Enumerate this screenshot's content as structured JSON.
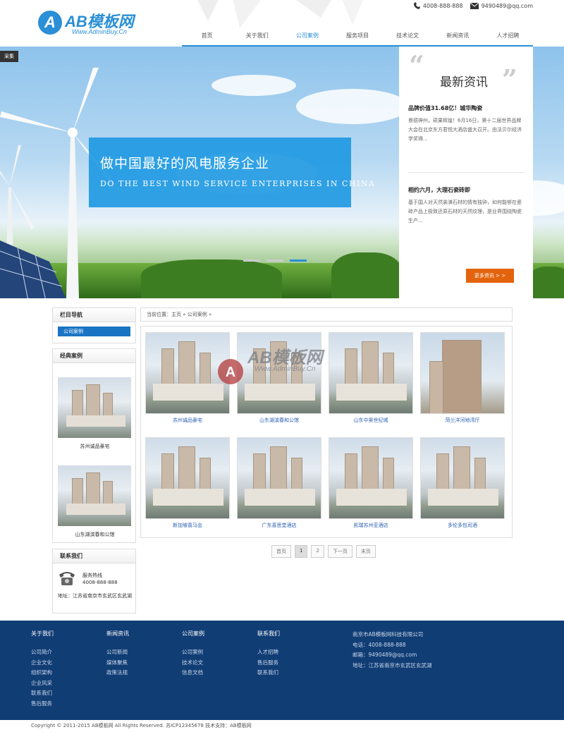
{
  "header": {
    "logo_text": "AB模板网",
    "logo_url": "Www.AdminBuy.Cn",
    "phone": "4008-888-888",
    "email": "9490489@qq.com",
    "nav": [
      "首页",
      "关于我们",
      "公司案例",
      "服务项目",
      "技术论文",
      "新闻资讯",
      "人才招聘"
    ]
  },
  "banner": {
    "badge": "采集",
    "caption_cn": "做中国最好的风电服务企业",
    "caption_en": "DO THE BEST WIND SERVICE ENTERPRISES IN CHINA",
    "active_slide": 3,
    "slide_count": 3
  },
  "news_box": {
    "title": "最新资讯",
    "items": [
      {
        "title": "品牌价值31.68亿！城华陶瓷",
        "text": "景德神州，硕果辉煌！6月16日，第十二届世界品牌大会在北京东方君悦大酒店盛大召开。由法贝尔经济学奖得..."
      },
      {
        "title": "相约六月，大理石瓷砖即",
        "text": "基于国人对天然装潢石材的情有独钟，如何能够在瓷砖产品上极致还原石材的天然纹理，是业界围绕陶瓷生产..."
      }
    ],
    "more_label": "更多资讯 > >"
  },
  "sidebar": {
    "nav_title": "栏目导航",
    "nav_active": "公司案例",
    "cases_title": "经典案例",
    "cases": [
      "苏州诚品豪宅",
      "山东湖滨春和公馆"
    ],
    "contact_title": "联系我们",
    "hotline_label": "服务热线",
    "hotline": "4008-888-888",
    "address": "地址：江苏省南京市玄武区玄武湖"
  },
  "breadcrumb": "当前位置：主页 » 公司案例 »",
  "products": [
    {
      "caption": "苏州诚品豪宅"
    },
    {
      "caption": "山东湖滨春和公馆"
    },
    {
      "caption": "山东中昊世纪城"
    },
    {
      "caption": "菏兰洋河地湾厅"
    },
    {
      "caption": "新加坡喜马会"
    },
    {
      "caption": "广东喜思堂酒店"
    },
    {
      "caption": "凯瑞苏州亚酒店"
    },
    {
      "caption": "多伦多包司酒"
    }
  ],
  "watermark": {
    "text": "AB模板网",
    "url": "Www.AdminBuy.Cn"
  },
  "pager": [
    "首页",
    "1",
    "2",
    "下一页",
    "末页"
  ],
  "footer": {
    "cols": [
      {
        "title": "关于我们",
        "links": [
          "公司简介",
          "企业文化",
          "组织架构",
          "企业风采",
          "联系我们",
          "售后服务"
        ]
      },
      {
        "title": "新闻资讯",
        "links": [
          "公司新闻",
          "媒体聚焦",
          "政策法规"
        ]
      },
      {
        "title": "公司案例",
        "links": [
          "公司案例",
          "技术论文",
          "信息文档"
        ]
      },
      {
        "title": "联系我们",
        "links": [
          "人才招聘",
          "售后服务",
          "联系我们"
        ]
      }
    ],
    "info": [
      "南京市AB模板网科技有限公司",
      "电话：4008-888-888",
      "邮箱：9490489@qq.com",
      "地址：江苏省南京市玄武区玄武湖"
    ],
    "copyright": "Copyright © 2011-2015 AB模板网 All Rights Reserved.    苏ICP12345678    技术支持：AB模板网"
  },
  "colors": {
    "brand": "#2a8fd6",
    "footer_bg": "#113d75",
    "more_btn": "#e4640e"
  }
}
